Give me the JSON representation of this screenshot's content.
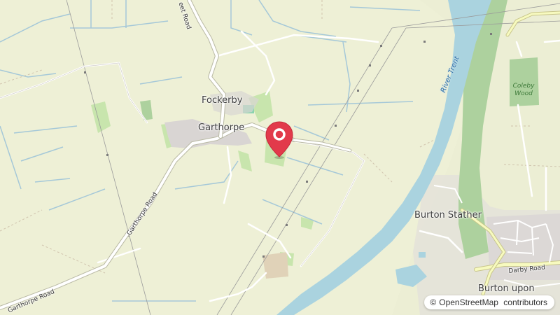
{
  "map": {
    "places": {
      "fockerby": "Fockerby",
      "garthorpe": "Garthorpe",
      "burton_stather": "Burton Stather",
      "burton_upon": "Burton upon"
    },
    "roads": {
      "garthorpe_road_1": "Garthorpe Road",
      "garthorpe_road_2": "Garthorpe Road",
      "top_road_fragment": "eet Road",
      "darby_road": "Darby Road"
    },
    "water": {
      "river_trent": "River Trent"
    },
    "woods": {
      "coleby_wood_line1": "Coleby",
      "coleby_wood_line2": "Wood"
    },
    "attribution": {
      "copyright_symbol": "©",
      "link_text": "OpenStreetMap",
      "suffix": " contributors"
    },
    "marker": {
      "icon": "map-pin-icon",
      "color": "#e23a4b"
    },
    "colors": {
      "land": "#eef0d6",
      "river": "#aad3df",
      "woodland": "#addd8e",
      "built": "#f2efe9",
      "minor_road": "#ffffff",
      "secondary_road": "#f7fabf"
    }
  }
}
